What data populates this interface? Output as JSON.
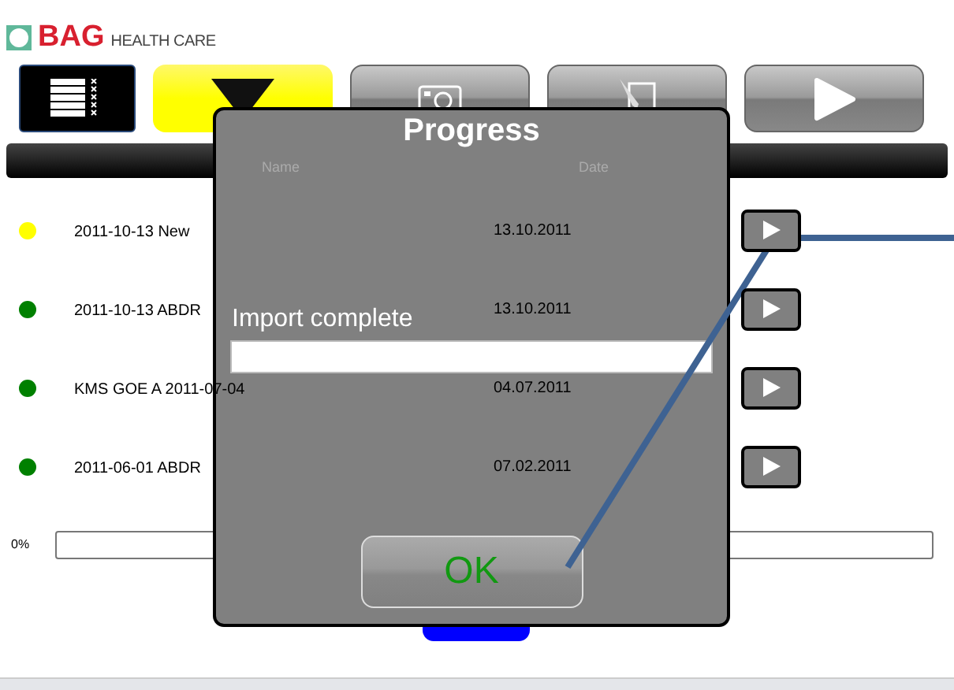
{
  "logo": {
    "brand": "BAG",
    "tagline": "HEALTH CARE"
  },
  "toolbar": [
    {
      "kind": "list",
      "selected": false
    },
    {
      "kind": "import",
      "selected": true
    },
    {
      "kind": "camera",
      "selected": false
    },
    {
      "kind": "edit",
      "selected": false
    },
    {
      "kind": "play",
      "selected": false
    }
  ],
  "table": {
    "columns": [
      "Name",
      "Date"
    ],
    "rows": [
      {
        "name": "2011-10-13 New",
        "date": "13.10.2011",
        "color": "#ffff00"
      },
      {
        "name": "2011-10-13 ABDR",
        "date": "13.10.2011",
        "color": "#008000"
      },
      {
        "name": "KMS GOE A 2011-07-04",
        "date": "04.07.2011",
        "color": "#008000"
      },
      {
        "name": "2011-06-01 ABDR",
        "date": "07.02.2011",
        "color": "#008000"
      }
    ]
  },
  "progress": {
    "label": "0%",
    "level": 0
  },
  "dialog": {
    "title": "Progress",
    "message": "Import complete",
    "ok": "OK"
  }
}
